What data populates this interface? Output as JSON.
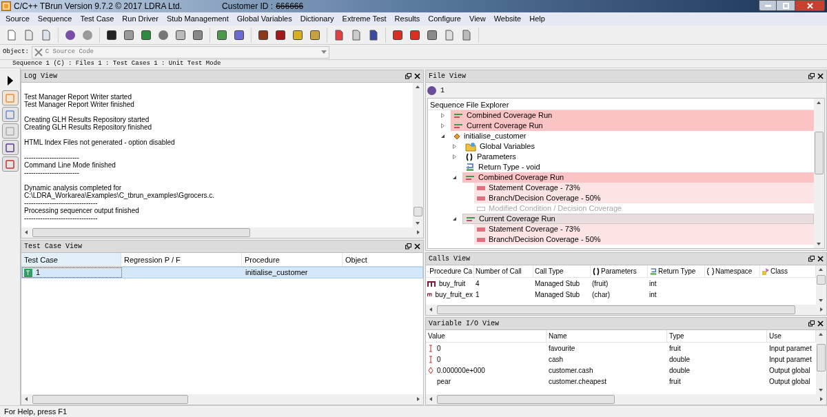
{
  "window": {
    "title": "C/C++ TBrun Version 9.7.2 © 2017 LDRA Ltd.",
    "customer_label": "Customer ID :",
    "customer_id": "666666"
  },
  "menu": [
    "Source",
    "Sequence",
    "Test Case",
    "Run Driver",
    "Stub Management",
    "Global Variables",
    "Dictionary",
    "Extreme Test",
    "Results",
    "Configure",
    "View",
    "Website",
    "Help"
  ],
  "object_field": {
    "label": "Object:",
    "value": "C Source Code"
  },
  "summary": "Sequence 1 (C) : Files 1 : Test Cases 1 : Unit Test Mode",
  "log_view": {
    "title": "Log View",
    "blocks": [
      [
        "Test Manager Report Writer started",
        "Test Manager Report Writer finished"
      ],
      [
        "Creating GLH Results Repository started",
        "Creating GLH Results Repository finished"
      ],
      [
        "HTML Index Files not generated - option disabled"
      ],
      [
        "------------------------",
        "Command Line Mode finished",
        "------------------------"
      ],
      [
        "Dynamic analysis completed for",
        "C:\\LDRA_Workarea\\Examples\\C_tbrun_examples\\Ggrocers.c.",
        "--------------------------------",
        "Processing sequencer output finished",
        "--------------------------------"
      ]
    ]
  },
  "test_case_view": {
    "title": "Test Case View",
    "columns": [
      "Test Case",
      "Regression P / F",
      "Procedure",
      "Object"
    ],
    "rows": [
      {
        "test_case": "1",
        "procedure": "initialise_customer",
        "selected": true
      }
    ]
  },
  "file_view": {
    "title": "File View",
    "sequence": "1",
    "explorer_title": "Sequence File Explorer",
    "tree": [
      {
        "label": "Combined Coverage Run",
        "kind": "run",
        "color": "#fbc4c4",
        "selected": false,
        "disabled": false,
        "expanded": false
      },
      {
        "label": "Current Coverage Run",
        "kind": "run",
        "color": "#fbc4c4",
        "selected": false,
        "disabled": false,
        "expanded": false
      },
      {
        "label": "initialise_customer",
        "kind": "function",
        "selected": false,
        "disabled": false,
        "expanded": true,
        "children": [
          {
            "label": "Global Variables",
            "kind": "globals",
            "selected": false,
            "disabled": false,
            "expanded": false
          },
          {
            "label": "Parameters",
            "kind": "parameters",
            "selected": false,
            "disabled": false,
            "expanded": false
          },
          {
            "label": "Return Type - void",
            "kind": "return",
            "selected": false,
            "disabled": false
          },
          {
            "label": "Combined Coverage Run",
            "kind": "run",
            "color": "#fbc4c4",
            "selected": false,
            "disabled": false,
            "expanded": true,
            "children": [
              {
                "label": "Statement Coverage - 73%",
                "kind": "metric",
                "color": "#fde4e4",
                "selected": false,
                "disabled": false
              },
              {
                "label": "Branch/Decision Coverage - 50%",
                "kind": "metric",
                "color": "#fde4e4",
                "selected": false,
                "disabled": false
              },
              {
                "label": "Modified Condition / Decision Coverage",
                "kind": "metric",
                "selected": false,
                "disabled": true
              }
            ]
          },
          {
            "label": "Current Coverage Run",
            "kind": "run",
            "selected": true,
            "disabled": false,
            "expanded": true,
            "children": [
              {
                "label": "Statement Coverage - 73%",
                "kind": "metric",
                "color": "#fde4e4",
                "selected": false,
                "disabled": false
              },
              {
                "label": "Branch/Decision Coverage - 50%",
                "kind": "metric",
                "color": "#fde4e4",
                "selected": false,
                "disabled": false
              }
            ]
          }
        ]
      }
    ]
  },
  "calls_view": {
    "title": "Calls View",
    "columns": [
      "Procedure Ca",
      "Number of Call",
      "Call Type",
      "Parameters",
      "Return Type",
      "Namespace",
      "Class"
    ],
    "rows": [
      {
        "procedure": "buy_fruit",
        "calls": "4",
        "call_type": "Managed Stub",
        "parameters": "(fruit)",
        "return_type": "int"
      },
      {
        "procedure": "buy_fruit_ex",
        "calls": "1",
        "call_type": "Managed Stub",
        "parameters": "(char)",
        "return_type": "int"
      }
    ]
  },
  "variable_view": {
    "title": "Variable I/O View",
    "columns": [
      "Value",
      "Name",
      "Type",
      "Use"
    ],
    "rows": [
      {
        "kind": "input",
        "value": "0",
        "name": "favourite",
        "type": "fruit",
        "use": "Input paramet"
      },
      {
        "kind": "input",
        "value": "0",
        "name": "cash",
        "type": "double",
        "use": "Input paramet"
      },
      {
        "kind": "output",
        "value": "0.000000e+000",
        "name": "customer.cash",
        "type": "double",
        "use": "Output global"
      },
      {
        "kind": "hidden",
        "value": "pear",
        "name": "customer.cheapest",
        "type": "fruit",
        "use": "Output global"
      }
    ]
  },
  "status_bar": "For Help, press F1"
}
